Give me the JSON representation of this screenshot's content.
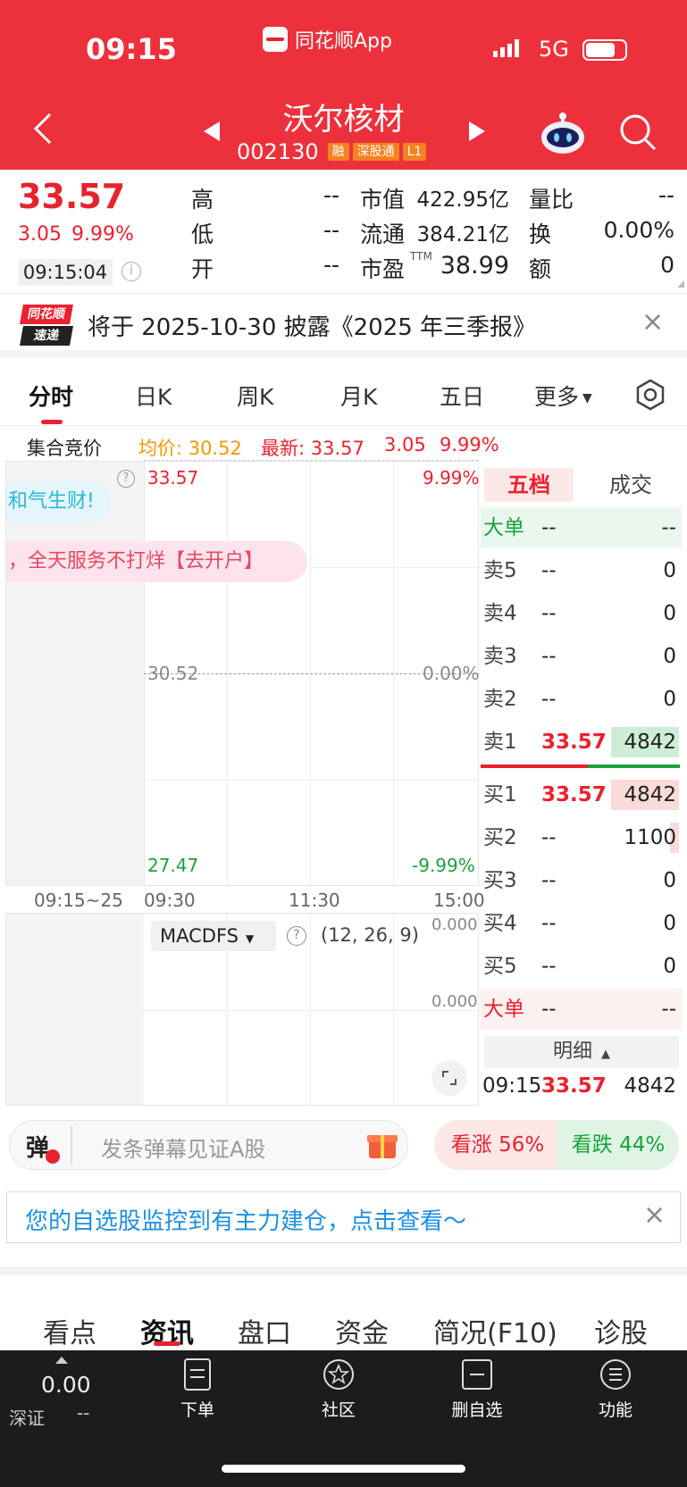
{
  "status_bar": {
    "time": "09:15",
    "app_label": "同花顺App",
    "network": "5G"
  },
  "header": {
    "title": "沃尔核材",
    "code": "002130",
    "tags": [
      "融",
      "深股通",
      "L1"
    ]
  },
  "quote": {
    "price": "33.57",
    "change": "3.05",
    "change_pct": "9.99%",
    "time": "09:15:04",
    "fields": {
      "high_l": "高",
      "high_v": "--",
      "low_l": "低",
      "low_v": "--",
      "open_l": "开",
      "open_v": "--",
      "mcap_l": "市值",
      "mcap_v": "422.95亿",
      "float_l": "流通",
      "float_v": "384.21亿",
      "pe_l": "市盈",
      "pe_sup": "TTM",
      "pe_v": "38.99",
      "vr_l": "量比",
      "vr_v": "--",
      "turn_l": "换",
      "turn_v": "0.00%",
      "amt_l": "额",
      "amt_v": "0"
    }
  },
  "news": {
    "logo_top": "同花顺",
    "logo_bottom": "速递",
    "text": "将于 2025-10-30 披露《2025 年三季报》"
  },
  "chart_tabs": [
    "分时",
    "日K",
    "周K",
    "月K",
    "五日",
    "更多"
  ],
  "auction": {
    "label": "集合竞价",
    "avg": "均价: 30.52",
    "latest": "最新: 33.57",
    "chg": "3.05",
    "pct": "9.99%"
  },
  "chart": {
    "top_price": "33.57",
    "top_pct": "9.99%",
    "mid_price": "30.52",
    "mid_pct": "0.00%",
    "bot_price": "27.47",
    "bot_pct": "-9.99%",
    "x_labels": [
      "09:15~25",
      "09:30",
      "11:30",
      "15:00"
    ],
    "bubble1": "和气生财!",
    "bubble2": "，全天服务不打烊【去开户】"
  },
  "macd": {
    "name": "MACDFS",
    "params": "(12, 26, 9)",
    "v1": "0.000",
    "v2": "0.000"
  },
  "orderbook": {
    "tab_active": "五档",
    "tab_other": "成交",
    "big_top": {
      "label": "大单",
      "p": "--",
      "v": "--"
    },
    "sells": [
      {
        "label": "卖5",
        "p": "--",
        "v": "0"
      },
      {
        "label": "卖4",
        "p": "--",
        "v": "0"
      },
      {
        "label": "卖3",
        "p": "--",
        "v": "0"
      },
      {
        "label": "卖2",
        "p": "--",
        "v": "0"
      },
      {
        "label": "卖1",
        "p": "33.57",
        "v": "4842"
      }
    ],
    "buys": [
      {
        "label": "买1",
        "p": "33.57",
        "v": "4842"
      },
      {
        "label": "买2",
        "p": "--",
        "v": "1100"
      },
      {
        "label": "买3",
        "p": "--",
        "v": "0"
      },
      {
        "label": "买4",
        "p": "--",
        "v": "0"
      },
      {
        "label": "买5",
        "p": "--",
        "v": "0"
      }
    ],
    "big_bot": {
      "label": "大单",
      "p": "--",
      "v": "--"
    },
    "detail_label": "明细",
    "detail_time": "09:15",
    "detail_price": "33.57",
    "detail_vol": "4842"
  },
  "danmu": {
    "icon": "弹",
    "placeholder": "发条弹幕见证A股",
    "up": "看涨 56%",
    "down": "看跌 44%"
  },
  "alert": {
    "text": "您的自选股监控到有主力建仓，点击查看～"
  },
  "bottom_tabs": [
    "看点",
    "资讯",
    "盘口",
    "资金",
    "简况(F10)",
    "诊股"
  ],
  "navbar": {
    "index_value": "0.00",
    "index_name": "深证",
    "index_change": "--",
    "items": [
      "下单",
      "社区",
      "删自选",
      "功能"
    ]
  }
}
